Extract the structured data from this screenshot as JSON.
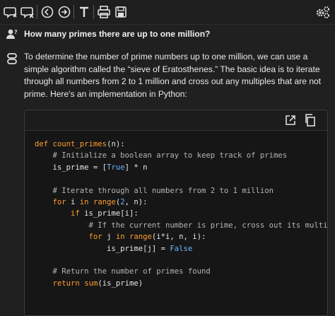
{
  "question": "How many primes there are up to one million?",
  "answer": {
    "text": "To determine the number of prime numbers up to one million, we can use a simple algorithm called the “sieve of Eratosthenes.” The basic idea is to iterate through all numbers from 2 to 1 million and cross out any multiples that are not prime. Here's an implementation in Python:"
  },
  "code": {
    "lines": [
      [
        {
          "t": "def ",
          "c": "kw"
        },
        {
          "t": "count_primes",
          "c": "fn"
        },
        {
          "t": "(n):",
          "c": ""
        }
      ],
      [
        {
          "t": "    # Initialize a boolean array to keep track of primes",
          "c": "cm"
        }
      ],
      [
        {
          "t": "    is_prime = [",
          "c": ""
        },
        {
          "t": "True",
          "c": "cst"
        },
        {
          "t": "] * n",
          "c": ""
        }
      ],
      [
        {
          "t": "",
          "c": ""
        }
      ],
      [
        {
          "t": "    # Iterate through all numbers from 2 to 1 million",
          "c": "cm"
        }
      ],
      [
        {
          "t": "    ",
          "c": ""
        },
        {
          "t": "for",
          "c": "kw"
        },
        {
          "t": " i ",
          "c": ""
        },
        {
          "t": "in",
          "c": "kw"
        },
        {
          "t": " ",
          "c": ""
        },
        {
          "t": "range",
          "c": "bi"
        },
        {
          "t": "(",
          "c": ""
        },
        {
          "t": "2",
          "c": "num"
        },
        {
          "t": ", n):",
          "c": ""
        }
      ],
      [
        {
          "t": "        ",
          "c": ""
        },
        {
          "t": "if",
          "c": "kw"
        },
        {
          "t": " is_prime[i]:",
          "c": ""
        }
      ],
      [
        {
          "t": "            # If the current number is prime, cross out its multiples",
          "c": "cm"
        }
      ],
      [
        {
          "t": "            ",
          "c": ""
        },
        {
          "t": "for",
          "c": "kw"
        },
        {
          "t": " j ",
          "c": ""
        },
        {
          "t": "in",
          "c": "kw"
        },
        {
          "t": " ",
          "c": ""
        },
        {
          "t": "range",
          "c": "bi"
        },
        {
          "t": "(i*i, n, i):",
          "c": ""
        }
      ],
      [
        {
          "t": "                is_prime[j] = ",
          "c": ""
        },
        {
          "t": "False",
          "c": "cst"
        }
      ],
      [
        {
          "t": "",
          "c": ""
        }
      ],
      [
        {
          "t": "    # Return the number of primes found",
          "c": "cm"
        }
      ],
      [
        {
          "t": "    ",
          "c": ""
        },
        {
          "t": "return",
          "c": "kw"
        },
        {
          "t": " ",
          "c": ""
        },
        {
          "t": "sum",
          "c": "bi"
        },
        {
          "t": "(is_prime)",
          "c": ""
        }
      ]
    ]
  },
  "icons": {
    "toolbar": [
      "regenerate-icon",
      "clear-chat-icon",
      "rewind-icon",
      "forward-icon",
      "text-icon",
      "print-icon",
      "save-icon",
      "settings-icon"
    ],
    "code_box": [
      "open-external-icon",
      "copy-icon"
    ]
  },
  "colors": {
    "background": "#202020",
    "keyword": "#ff9d2e",
    "comment": "#b4b4b4",
    "constant": "#6cb6ff"
  }
}
